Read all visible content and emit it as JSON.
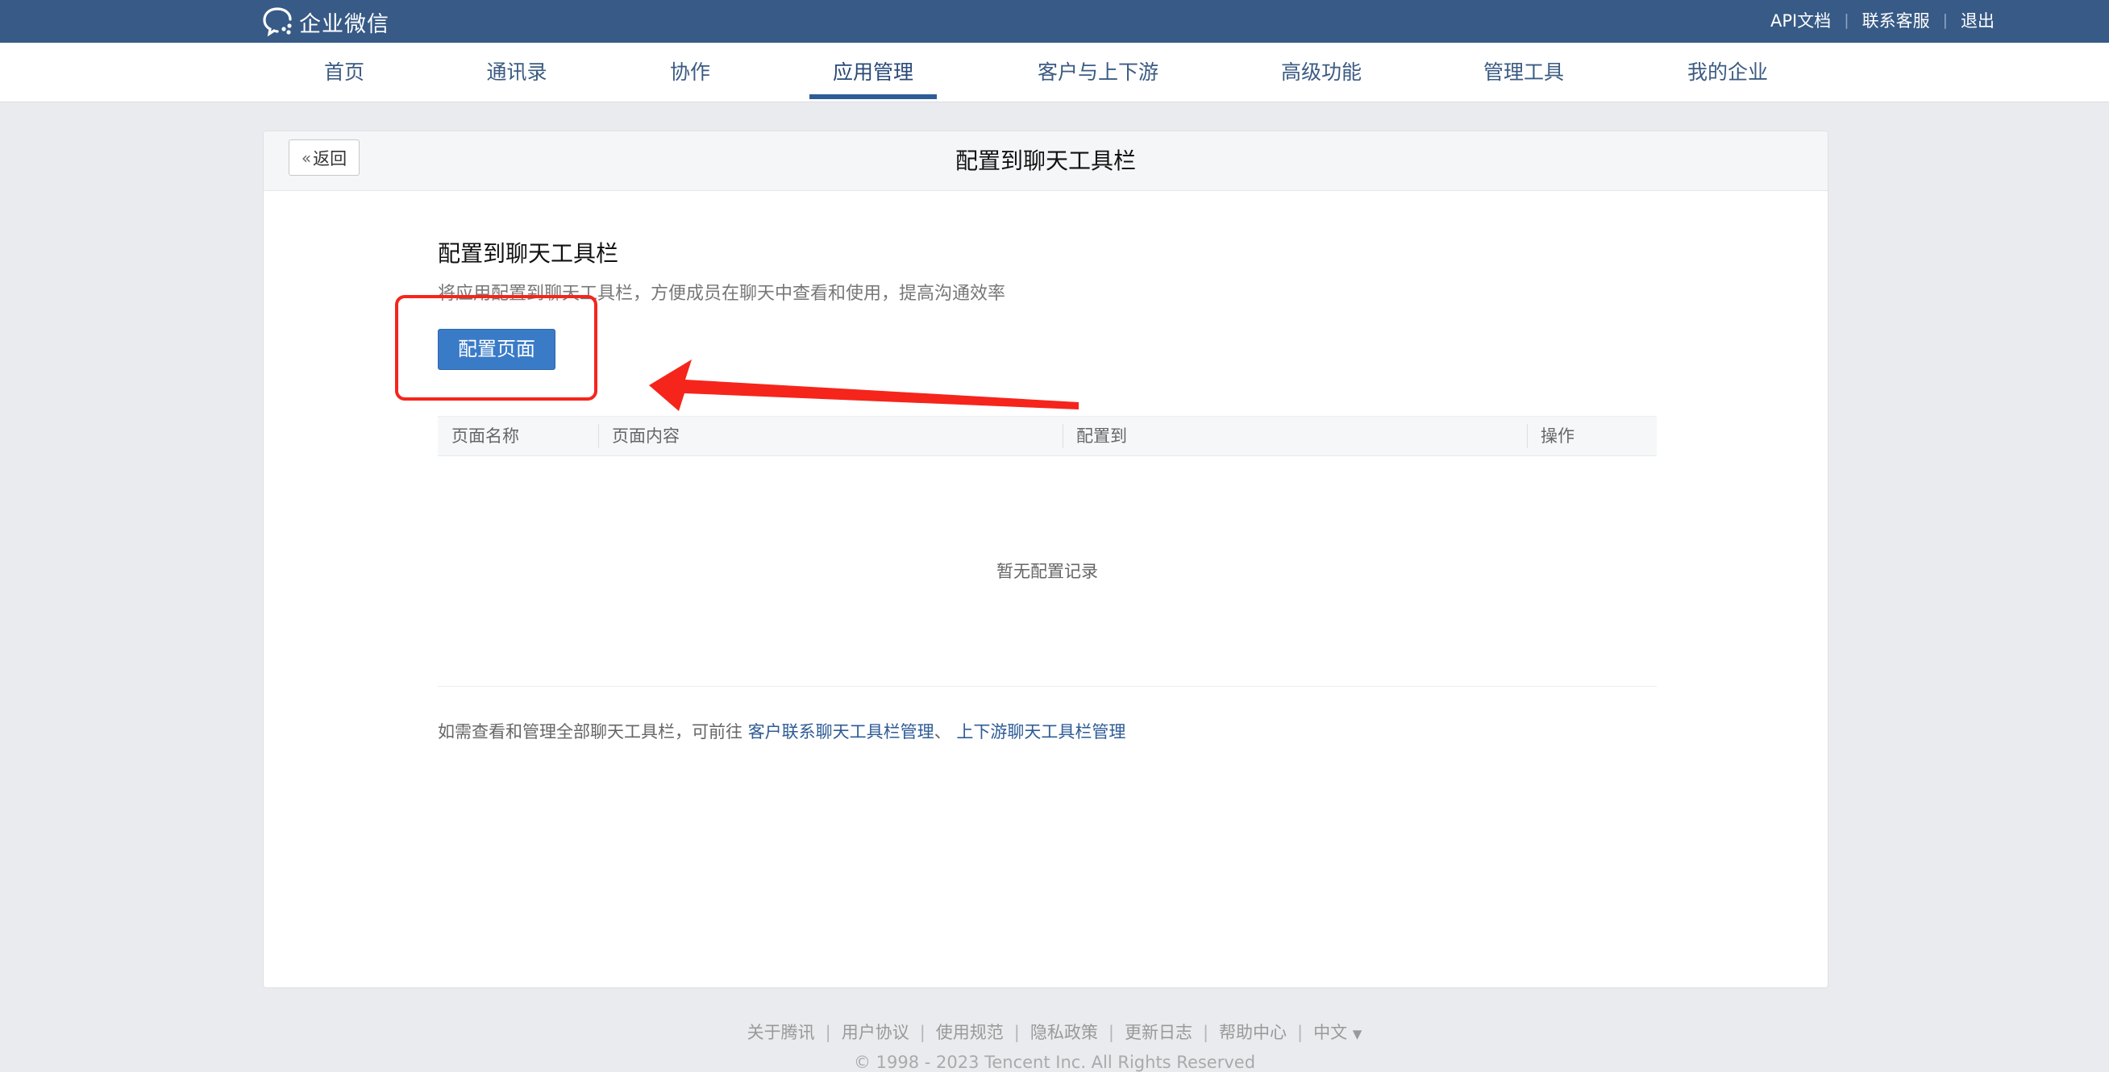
{
  "topbar": {
    "logo_text": "企业微信",
    "links": [
      "API文档",
      "联系客服",
      "退出"
    ]
  },
  "nav": {
    "items": [
      "首页",
      "通讯录",
      "协作",
      "应用管理",
      "客户与上下游",
      "高级功能",
      "管理工具",
      "我的企业"
    ],
    "active": "应用管理"
  },
  "panel": {
    "back_label": "返回",
    "title": "配置到聊天工具栏",
    "section_title": "配置到聊天工具栏",
    "section_desc": "将应用配置到聊天工具栏，方便成员在聊天中查看和使用，提高沟通效率",
    "config_button": "配置页面",
    "table": {
      "columns": [
        "页面名称",
        "页面内容",
        "配置到",
        "操作"
      ],
      "empty_text": "暂无配置记录"
    },
    "footnote": {
      "prefix": "如需查看和管理全部聊天工具栏，可前往",
      "link1": "客户联系聊天工具栏管理",
      "separator": "、",
      "link2": "上下游聊天工具栏管理"
    }
  },
  "footer": {
    "links": [
      "关于腾讯",
      "用户协议",
      "使用规范",
      "隐私政策",
      "更新日志",
      "帮助中心"
    ],
    "language": "中文",
    "copyright": "© 1998 - 2023 Tencent Inc. All Rights Reserved"
  },
  "colors": {
    "topbar": "#375a86",
    "primary_button": "#3a7bc8",
    "annotation_red": "#f5251c",
    "link": "#2e5b95"
  }
}
